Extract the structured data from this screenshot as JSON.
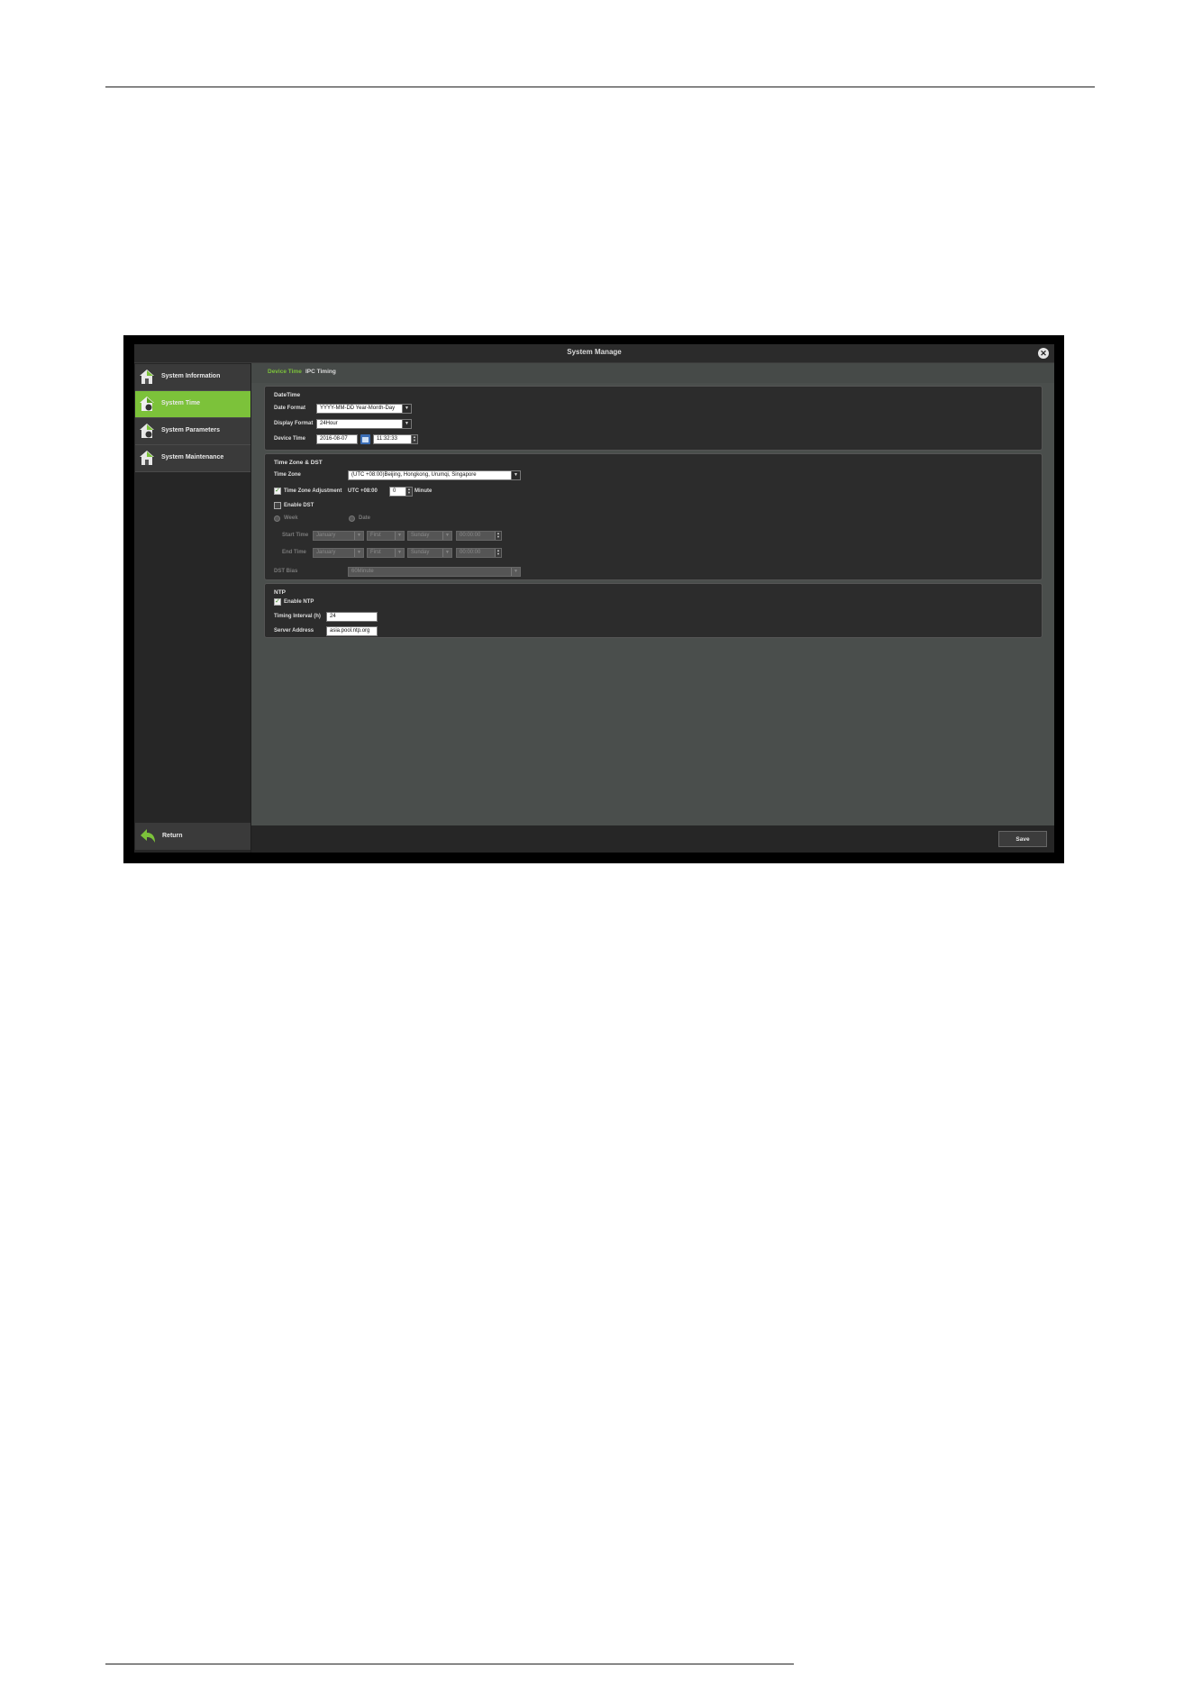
{
  "window": {
    "title": "System Manage"
  },
  "sidebar": {
    "items": [
      {
        "label": "System Information"
      },
      {
        "label": "System Time"
      },
      {
        "label": "System Parameters"
      },
      {
        "label": "System Maintenance"
      }
    ],
    "return_label": "Return"
  },
  "tabs": [
    {
      "label": "Device Time"
    },
    {
      "label": "IPC Timing"
    }
  ],
  "datetime": {
    "title": "DateTime",
    "date_format_label": "Date Format",
    "date_format_value": "YYYY-MM-DD Year-Month-Day",
    "display_format_label": "Display Format",
    "display_format_value": "24Hour",
    "device_time_label": "Device Time",
    "device_date_value": "2016-08-07",
    "device_time_value": "11:32:33"
  },
  "timezone": {
    "title": "Time Zone & DST",
    "time_zone_label": "Time Zone",
    "time_zone_value": "(UTC +08:00)Beijing, Hongkong, Urumqi, Singapore",
    "adjust_label": "Time Zone Adjustment",
    "adjust_prefix": "UTC +08:00",
    "adjust_value": "0",
    "adjust_unit": "Minute",
    "enable_dst_label": "Enable DST",
    "week_label": "Week",
    "date_label": "Date",
    "start_time_label": "Start Time",
    "end_time_label": "End Time",
    "start": {
      "month": "January",
      "week": "First",
      "day": "Sunday",
      "time": "00:00:00"
    },
    "end": {
      "month": "January",
      "week": "First",
      "day": "Sunday",
      "time": "00:00:00"
    },
    "dst_bias_label": "DST Bias",
    "dst_bias_value": "60Minute"
  },
  "ntp": {
    "title": "NTP",
    "enable_label": "Enable NTP",
    "interval_label": "Timing Interval (h)",
    "interval_value": "24",
    "server_label": "Server Address",
    "server_value": "asia.pool.ntp.org"
  },
  "footer": {
    "save_label": "Save"
  },
  "colors": {
    "accent": "#7cc23a",
    "window_bg": "#1e1e1e",
    "content_bg": "#4a4e4c"
  }
}
